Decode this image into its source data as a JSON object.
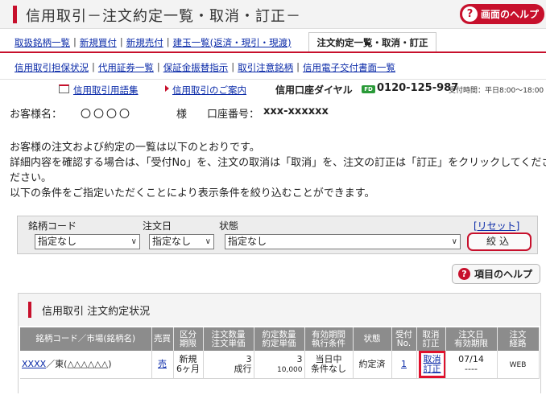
{
  "header": {
    "title": "信用取引－注文約定一覧・取消・訂正－",
    "help_label": "画面のヘルプ",
    "help_icon": "question-icon"
  },
  "nav1": {
    "items": [
      "取扱銘柄一覧",
      "新規買付",
      "新規売付",
      "建玉一覧(返済・現引・現渡)"
    ],
    "active": "注文約定一覧・取消・訂正"
  },
  "nav2": {
    "items": [
      "信用取引担保状況",
      "代用証券一覧",
      "保証金振替指示",
      "取引注意銘柄",
      "信用電子交付書面一覧"
    ]
  },
  "info": {
    "glossary": "信用取引用語集",
    "guide": "信用取引のご案内",
    "dial": "信用口座ダイヤル",
    "freedial": "FD",
    "phone": "0120-125-987",
    "hours": "受付時間：平日8:00～18:00"
  },
  "customer": {
    "label": "お客様名：",
    "name": "〇〇〇〇",
    "suffix": "様",
    "account_label": "口座番号：",
    "account": "xxx-xxxxxx"
  },
  "description": {
    "line1": "お客様の注文および約定の一覧は以下のとおりです。",
    "line2": "詳細内容を確認する場合は、「受付No」を、注文の取消は「取消」を、注文の訂正は「訂正」をクリックしてください。",
    "line3": "ださい。",
    "line4": "以下の条件をご指定いただくことにより表示条件を絞り込むことができます。"
  },
  "filter": {
    "stock_label": "銘柄コード",
    "stock_value": "指定なし",
    "date_label": "注文日",
    "date_value": "指定なし",
    "status_label": "状態",
    "status_value": "指定なし",
    "reset": "[リセット]",
    "narrow": "絞込"
  },
  "item_help": "項目のヘルプ",
  "panel": {
    "title": "信用取引 注文約定状況",
    "headers": [
      [
        "銘柄コード／市場(銘柄名)"
      ],
      [
        "売買"
      ],
      [
        "区分",
        "期限"
      ],
      [
        "注文数量",
        "注文単価"
      ],
      [
        "約定数量",
        "約定単価"
      ],
      [
        "有効期間",
        "執行条件"
      ],
      [
        "状態"
      ],
      [
        "受付",
        "No."
      ],
      [
        "取消",
        "訂正"
      ],
      [
        "注文日",
        "有効期限"
      ],
      [
        "注文",
        "経路"
      ]
    ],
    "row": {
      "code": "XXXX",
      "market": "／東(△△△△△△)",
      "side": "売",
      "kubun": "新規",
      "kigen": "6ヶ月",
      "order_qty": "3",
      "order_price": "成行",
      "exec_qty": "3",
      "exec_price": "10,000",
      "validity": "当日中",
      "condition": "条件なし",
      "status": "約定済",
      "receipt_no": "1",
      "cancel": "取消",
      "correct": "訂正",
      "order_date": "07/14",
      "expiry": "----",
      "route": "WEB"
    }
  },
  "colors": {
    "accent": "#c7102c",
    "link": "#0a2aa8",
    "table_header": "#8c8c8c",
    "highlight": "#e0102c"
  }
}
